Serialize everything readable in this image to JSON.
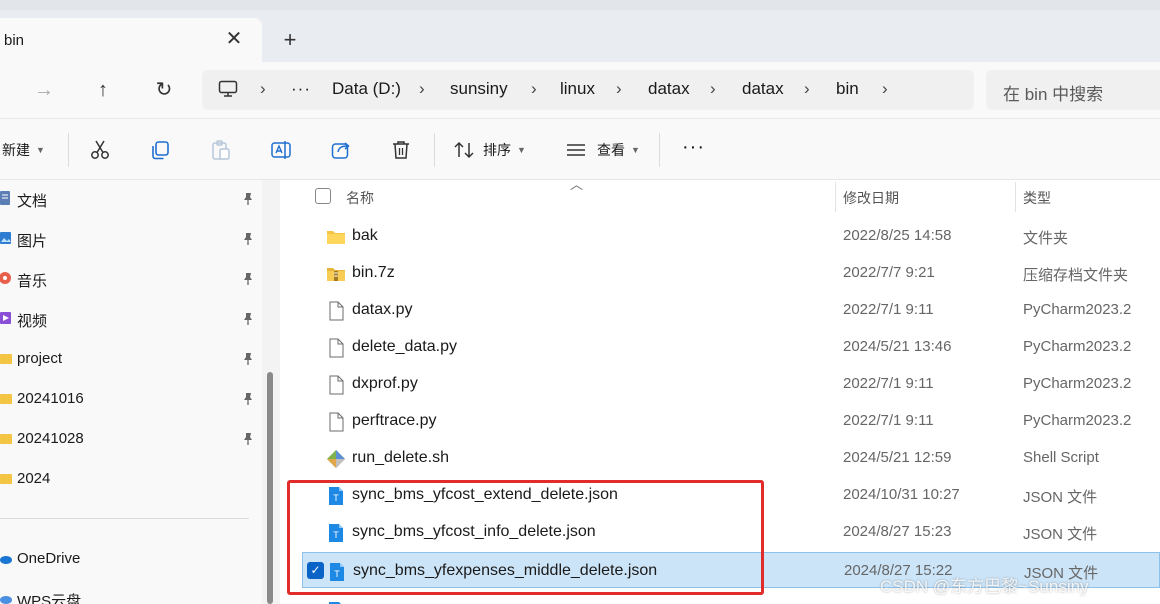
{
  "window": {
    "tab_title": "bin",
    "close_glyph": "✕",
    "new_tab_glyph": "+"
  },
  "nav": {
    "back_glyph": "←",
    "forward_glyph": "→",
    "up_glyph": "↑",
    "refresh_glyph": "↻",
    "more_glyph": "···",
    "breadcrumbs": [
      "Data (D:)",
      "sunsiny",
      "linux",
      "datax",
      "datax",
      "bin"
    ],
    "search_placeholder": "在 bin 中搜索"
  },
  "toolbar": {
    "new_label": "新建",
    "sort_label": "排序",
    "view_label": "查看",
    "more_glyph": "···"
  },
  "sidebar": {
    "items": [
      {
        "label": "文档",
        "icon": "documents-icon",
        "color": "#5b7fb5"
      },
      {
        "label": "图片",
        "icon": "pictures-icon",
        "color": "#2f7dd1"
      },
      {
        "label": "音乐",
        "icon": "music-icon",
        "color": "#e8604c"
      },
      {
        "label": "视频",
        "icon": "videos-icon",
        "color": "#8a4fd6"
      },
      {
        "label": "project",
        "icon": "folder-icon",
        "color": "#f4c542"
      },
      {
        "label": "20241016",
        "icon": "folder-icon",
        "color": "#f4c542"
      },
      {
        "label": "20241028",
        "icon": "folder-icon",
        "color": "#f4c542"
      },
      {
        "label": "2024",
        "icon": "folder-icon",
        "color": "#f4c542"
      }
    ],
    "onedrive_label": "OneDrive",
    "wps_label": "WPS云盘"
  },
  "list": {
    "headers": {
      "name": "名称",
      "modified": "修改日期",
      "type": "类型"
    },
    "rows": [
      {
        "name": "bak",
        "date": "2022/8/25 14:58",
        "type": "文件夹",
        "icon": "folder-icon"
      },
      {
        "name": "bin.7z",
        "date": "2022/7/7 9:21",
        "type": "压缩存档文件夹",
        "icon": "archive-icon"
      },
      {
        "name": "datax.py",
        "date": "2022/7/1 9:11",
        "type": "PyCharm2023.2",
        "icon": "file-icon"
      },
      {
        "name": "delete_data.py",
        "date": "2024/5/21 13:46",
        "type": "PyCharm2023.2",
        "icon": "file-icon"
      },
      {
        "name": "dxprof.py",
        "date": "2022/7/1 9:11",
        "type": "PyCharm2023.2",
        "icon": "file-icon"
      },
      {
        "name": "perftrace.py",
        "date": "2022/7/1 9:11",
        "type": "PyCharm2023.2",
        "icon": "file-icon"
      },
      {
        "name": "run_delete.sh",
        "date": "2024/5/21 12:59",
        "type": "Shell Script",
        "icon": "shell-script-icon"
      },
      {
        "name": "sync_bms_yfcost_extend_delete.json",
        "date": "2024/10/31 10:27",
        "type": "JSON 文件",
        "icon": "json-file-icon"
      },
      {
        "name": "sync_bms_yfcost_info_delete.json",
        "date": "2024/8/27 15:23",
        "type": "JSON 文件",
        "icon": "json-file-icon"
      },
      {
        "name": "sync_bms_yfexpenses_middle_delete.json",
        "date": "2024/8/27 15:22",
        "type": "JSON 文件",
        "icon": "json-file-icon",
        "selected": true
      }
    ]
  },
  "watermark": "CSDN @东方巴黎~Sunsiny",
  "colors": {
    "accent": "#0a64c8",
    "selection": "#cce4f7",
    "annotation": "#e22b2b"
  }
}
